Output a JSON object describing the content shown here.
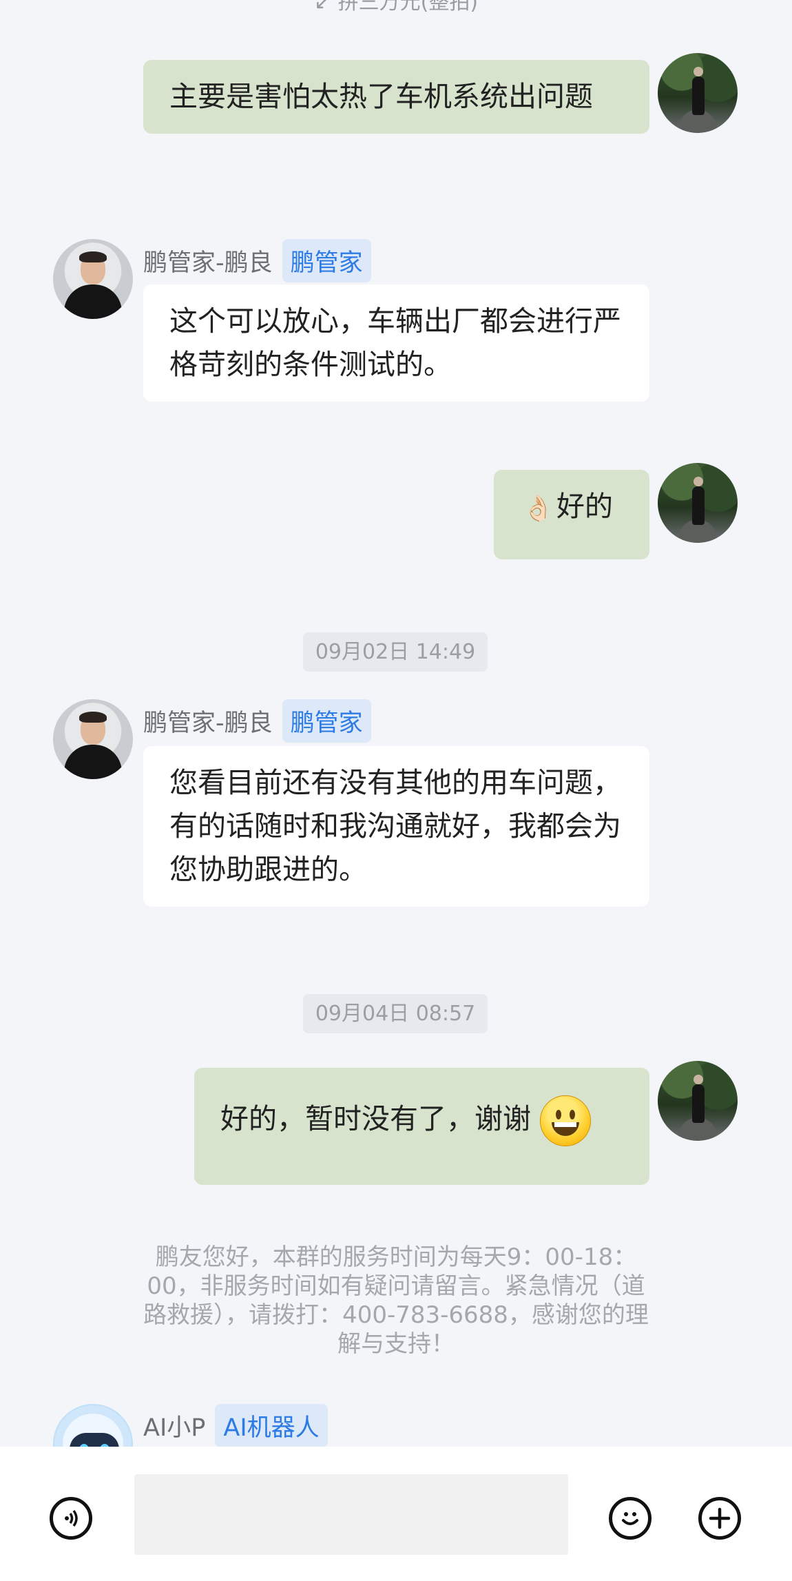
{
  "chat": {
    "cut_text": "↙ 拼三万元(整拍)",
    "messages": [
      {
        "text": "主要是害怕太热了车机系统出问题"
      },
      {
        "sender": "鹏管家-鹏良",
        "tag": "鹏管家",
        "text": "这个可以放心，车辆出厂都会进行严格苛刻的条件测试的。"
      },
      {
        "emoji": "👌🏻",
        "text": "好的"
      },
      {
        "time": "09月02日 14:49"
      },
      {
        "sender": "鹏管家-鹏良",
        "tag": "鹏管家",
        "text": "您看目前还有没有其他的用车问题，有的话随时和我沟通就好，我都会为您协助跟进的。"
      },
      {
        "time": "09月04日 08:57"
      },
      {
        "text": "好的，暂时没有了，谢谢"
      },
      {
        "notice": "鹏友您好，本群的服务时间为每天9：00-18：00，非服务时间如有疑问请留言。紧急情况（道路救援），请拨打：400-783-6688，感谢您的理解与支持！"
      },
      {
        "sender": "AI小P",
        "tag": "AI机器人"
      }
    ]
  },
  "toolbar": {
    "voice_icon": "voice-icon",
    "emoji_icon": "emoji-icon",
    "plus_icon": "plus-icon",
    "input_placeholder": ""
  }
}
